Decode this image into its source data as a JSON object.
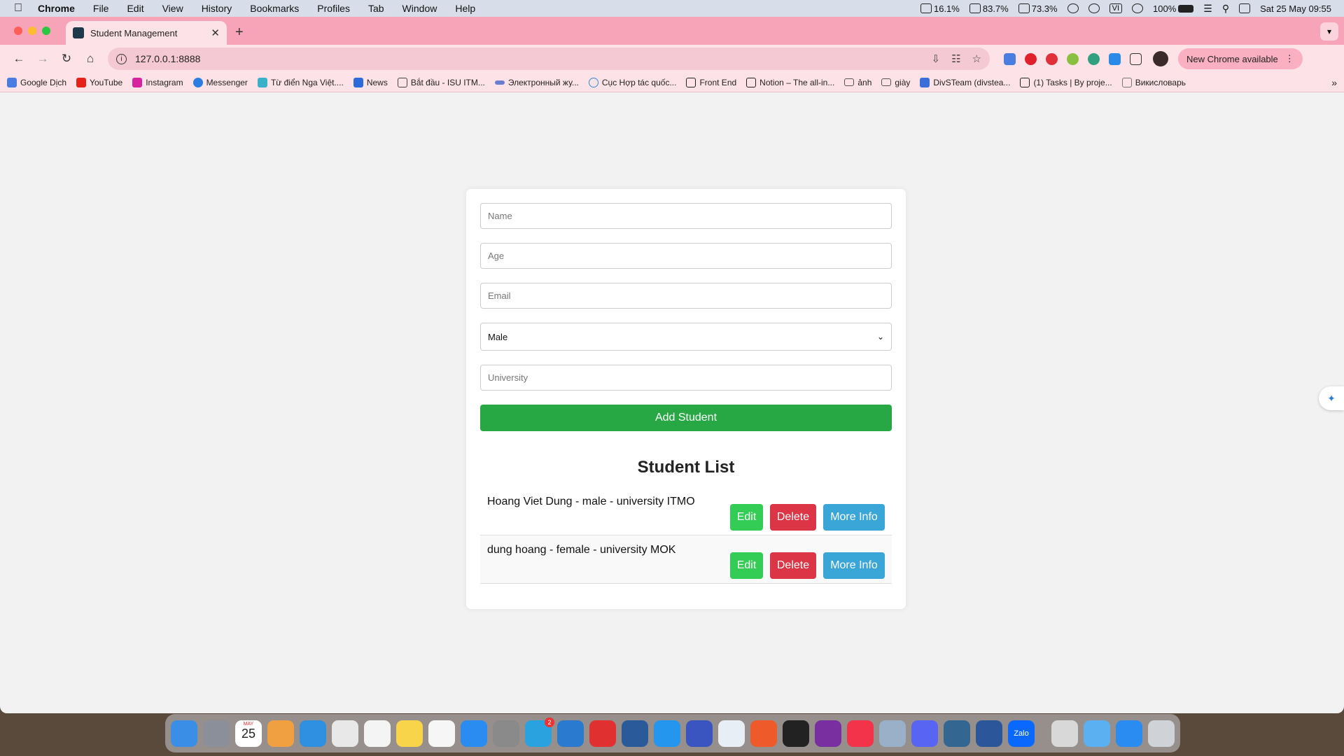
{
  "menubar": {
    "app_name": "Chrome",
    "items": [
      "File",
      "Edit",
      "View",
      "History",
      "Bookmarks",
      "Profiles",
      "Tab",
      "Window",
      "Help"
    ],
    "status": {
      "cpu": "16.1%",
      "memory": "83.7%",
      "disk": "73.3%",
      "battery": "100%",
      "input_lang": "VI",
      "datetime": "Sat 25 May  09:55"
    }
  },
  "browser": {
    "tab_title": "Student Management",
    "url": "127.0.0.1:8888",
    "update_label": "New Chrome available",
    "bookmarks": [
      {
        "label": "Google Dịch",
        "color": "#4a7de0"
      },
      {
        "label": "YouTube",
        "color": "#e62117"
      },
      {
        "label": "Instagram",
        "color": "#d6249f"
      },
      {
        "label": "Messenger",
        "color": "#2a7de1"
      },
      {
        "label": "Từ điển Nga Việt....",
        "color": "#3bb0c9"
      },
      {
        "label": "News",
        "color": "#2d6ad9"
      },
      {
        "label": "Bắt đầu - ISU ITM...",
        "color": "#444444"
      },
      {
        "label": "Электронный жу...",
        "color": "#6a7fd0"
      },
      {
        "label": "Cục Hợp tác quốc...",
        "color": "#3a8ad0"
      },
      {
        "label": "Front End",
        "color": "#222222"
      },
      {
        "label": "Notion – The all-in...",
        "color": "#222222"
      },
      {
        "label": "ảnh",
        "color": "#555555"
      },
      {
        "label": "giày",
        "color": "#555555"
      },
      {
        "label": "DivSTeam (divstea...",
        "color": "#3a6ed8"
      },
      {
        "label": "(1) Tasks | By proje...",
        "color": "#222222"
      },
      {
        "label": "Викисловарь",
        "color": "#777777"
      }
    ]
  },
  "form": {
    "name_placeholder": "Name",
    "age_placeholder": "Age",
    "email_placeholder": "Email",
    "gender_value": "Male",
    "university_placeholder": "University",
    "add_button": "Add Student"
  },
  "list": {
    "title": "Student List",
    "students": [
      {
        "text": "Hoang Viet Dung - male - university ITMO",
        "edit": "Edit",
        "delete": "Delete",
        "info": "More Info"
      },
      {
        "text": "dung hoang - female - university MOK",
        "edit": "Edit",
        "delete": "Delete",
        "info": "More Info"
      }
    ]
  },
  "dock": {
    "calendar_day": "25",
    "calendar_month": "MAY",
    "telegram_badge": "2",
    "zalo_label": "Zalo",
    "apps": [
      {
        "name": "finder",
        "color": "#3a8ee6"
      },
      {
        "name": "launchpad",
        "color": "#8a8f9a"
      },
      {
        "name": "calendar",
        "color": "#ffffff"
      },
      {
        "name": "photos",
        "color": "#f0a040"
      },
      {
        "name": "safari",
        "color": "#2f8fe0"
      },
      {
        "name": "chrome",
        "color": "#e8e8e8"
      },
      {
        "name": "freeform",
        "color": "#f4f4f4"
      },
      {
        "name": "notes",
        "color": "#f7d44a"
      },
      {
        "name": "reminders",
        "color": "#f6f6f6"
      },
      {
        "name": "app-store",
        "color": "#2a8cf0"
      },
      {
        "name": "system-settings",
        "color": "#8a8a8a"
      },
      {
        "name": "telegram",
        "color": "#2aa2e0"
      },
      {
        "name": "vscode",
        "color": "#2a7ad0"
      },
      {
        "name": "parallels",
        "color": "#e03030"
      },
      {
        "name": "virtualbox",
        "color": "#2a5a9a"
      },
      {
        "name": "docker",
        "color": "#2496ed"
      },
      {
        "name": "vmware",
        "color": "#3a55c0"
      },
      {
        "name": "sourcetree",
        "color": "#e8eef6"
      },
      {
        "name": "pen-tool",
        "color": "#ee5a2a"
      },
      {
        "name": "terminal",
        "color": "#222222"
      },
      {
        "name": "onenote",
        "color": "#7a2fa0"
      },
      {
        "name": "music",
        "color": "#f2334a"
      },
      {
        "name": "preview",
        "color": "#9ab0c8"
      },
      {
        "name": "discord",
        "color": "#5865f2"
      },
      {
        "name": "postgres",
        "color": "#336791"
      },
      {
        "name": "word",
        "color": "#2b579a"
      },
      {
        "name": "zalo",
        "color": "#0a68ff"
      },
      {
        "name": "downloads",
        "color": "#d8d8d8"
      },
      {
        "name": "folder",
        "color": "#5ab0f0"
      },
      {
        "name": "app-store-2",
        "color": "#2a8cf0"
      },
      {
        "name": "trash",
        "color": "#cfd3d8"
      }
    ]
  }
}
